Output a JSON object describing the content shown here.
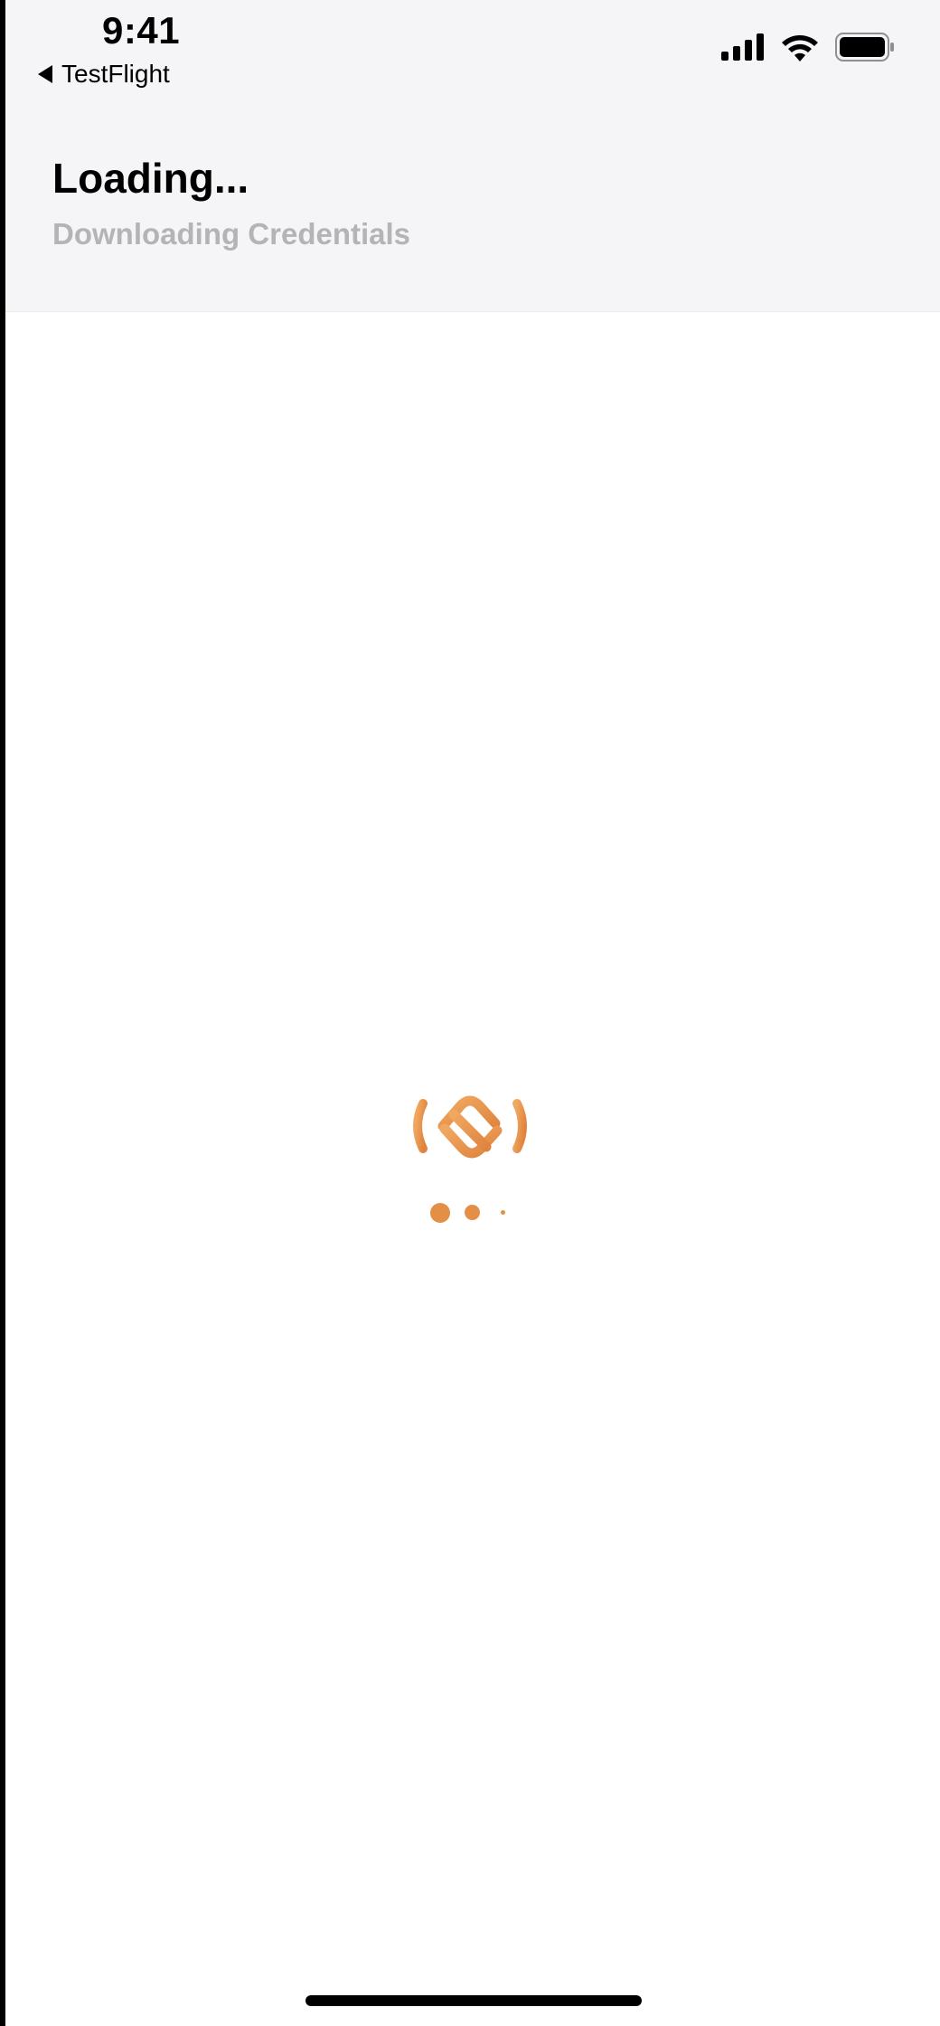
{
  "status_bar": {
    "time": "9:41",
    "back_label": "TestFlight"
  },
  "header": {
    "title": "Loading...",
    "subtitle": "Downloading Credentials"
  },
  "icons": {
    "signal": "cellular-signal-icon",
    "wifi": "wifi-icon",
    "battery": "battery-icon",
    "logo": "app-logo-icon"
  },
  "colors": {
    "accent": "#e48f46",
    "header_bg": "#f5f4f7",
    "subtitle": "#b4b3b8"
  }
}
